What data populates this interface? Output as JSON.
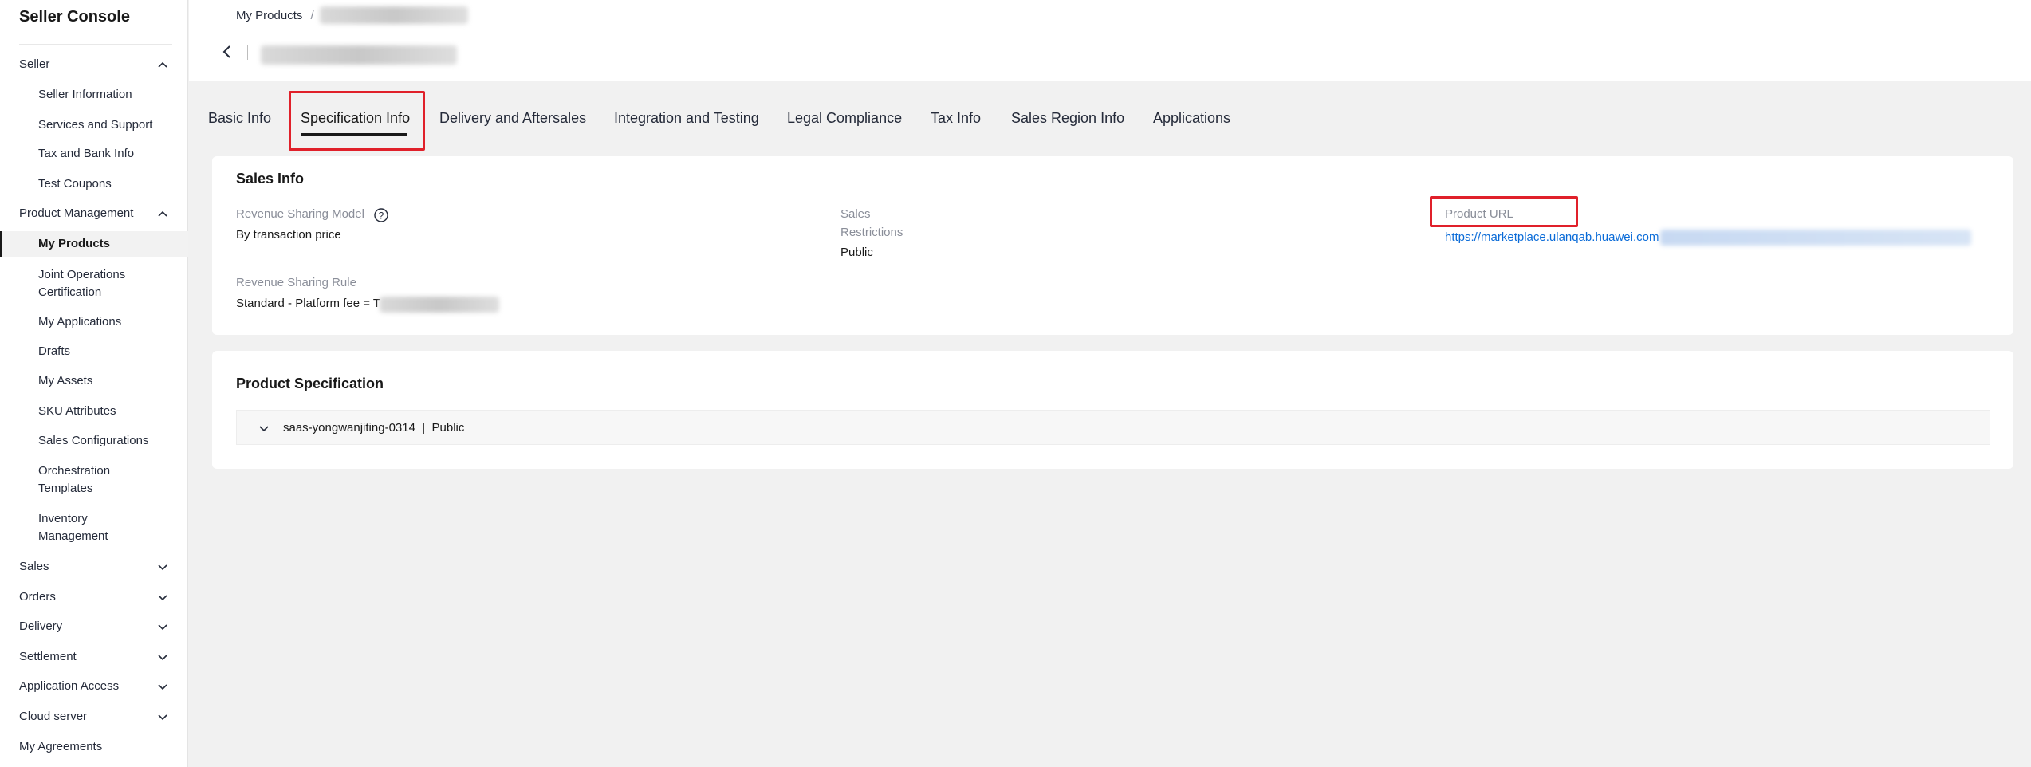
{
  "sidebar": {
    "brand": "Seller Console",
    "sections": [
      {
        "label": "Seller"
      },
      {
        "label": "Product Management"
      },
      {
        "label": "Sales"
      },
      {
        "label": "Orders"
      },
      {
        "label": "Delivery"
      },
      {
        "label": "Settlement"
      },
      {
        "label": "Application Access"
      },
      {
        "label": "Cloud server"
      },
      {
        "label": "My Agreements"
      }
    ],
    "seller_items": [
      "Seller Information",
      "Services and Support",
      "Tax and Bank Info",
      "Test Coupons"
    ],
    "product_items": [
      "My Products",
      "Joint Operations Certification",
      "My Applications",
      "Drafts",
      "My Assets",
      "SKU Attributes",
      "Sales Configurations",
      "Orchestration Templates",
      "Inventory Management"
    ]
  },
  "header": {
    "breadcrumb_root": "My Products",
    "breadcrumb_sep": "/"
  },
  "tabs": [
    "Basic Info",
    "Specification Info",
    "Delivery and Aftersales",
    "Integration and Testing",
    "Legal Compliance",
    "Tax Info",
    "Sales Region Info",
    "Applications"
  ],
  "active_tab": "Specification Info",
  "sales_info": {
    "title": "Sales Info",
    "revenue_model_label": "Revenue Sharing Model",
    "revenue_model_value": "By transaction price",
    "revenue_rule_label": "Revenue Sharing Rule",
    "revenue_rule_value": "Standard - Platform fee = T",
    "sales_label_1": "Sales",
    "sales_label_2": "Restrictions",
    "sales_value": "Public",
    "product_url_label": "Product URL",
    "product_url_value": "https://marketplace.ulanqab.huawei.com"
  },
  "product_spec": {
    "title": "Product Specification",
    "row_text": "saas-yongwanjiting-0314  |  Public"
  },
  "colors": {
    "highlight": "#e0202a",
    "link": "#0a6bd8",
    "background": "#f1f1f1"
  }
}
